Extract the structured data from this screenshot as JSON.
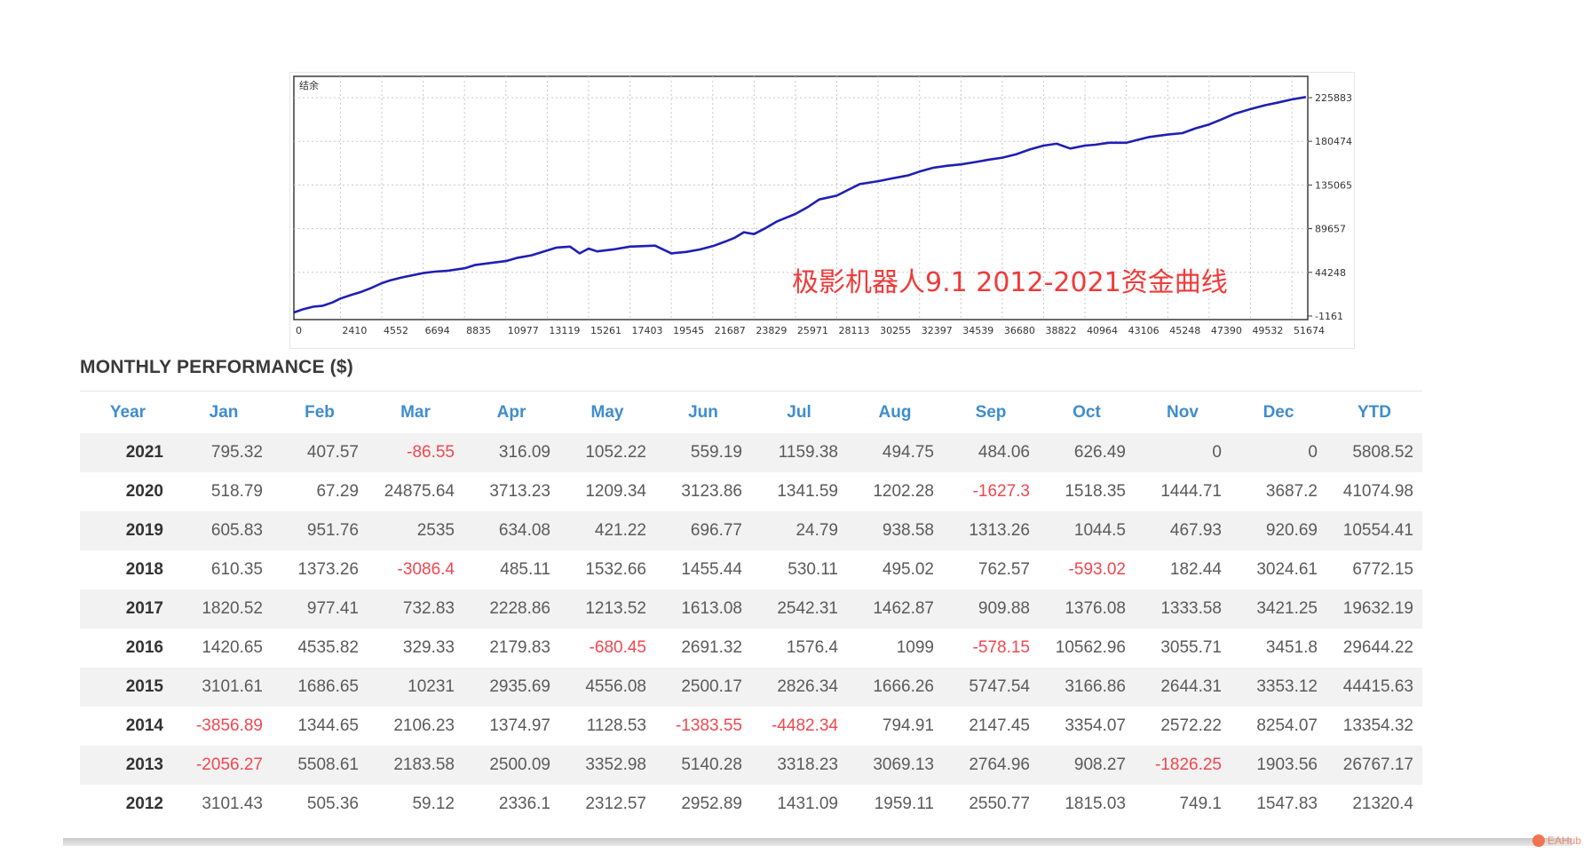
{
  "chart_data": {
    "type": "line",
    "corner_label": "结余",
    "overlay_text": "极影机器人9.1  2012-2021资金曲线",
    "x_ticks": [
      "0",
      "2410",
      "4552",
      "6694",
      "8835",
      "10977",
      "13119",
      "15261",
      "17403",
      "19545",
      "21687",
      "23829",
      "25971",
      "28113",
      "30255",
      "32397",
      "34539",
      "36680",
      "38822",
      "40964",
      "43106",
      "45248",
      "47390",
      "49532",
      "51674"
    ],
    "y_ticks": [
      "225883",
      "180474",
      "135065",
      "89657",
      "44248",
      "-1161"
    ],
    "xlim": [
      0,
      52500
    ],
    "ylim": [
      -1161,
      225883
    ],
    "grid": true,
    "line_color": "#1f1fb4",
    "series": [
      {
        "x": [
          0,
          500,
          1000,
          1500,
          2000,
          2410,
          3000,
          3500,
          4000,
          4552,
          5000,
          5600,
          6200,
          6694,
          7300,
          8000,
          8835,
          9400,
          10200,
          10977,
          11600,
          12300,
          13119,
          13600,
          14300,
          14800,
          15261,
          15700,
          16500,
          17403,
          18000,
          18700,
          19545,
          20300,
          21000,
          21687,
          22300,
          22800,
          23300,
          23829,
          24400,
          25000,
          25971,
          26600,
          27200,
          28113,
          28700,
          29300,
          30255,
          31000,
          31800,
          32397,
          33100,
          33800,
          34539,
          35300,
          36000,
          36680,
          37400,
          38100,
          38822,
          39500,
          40200,
          40964,
          41500,
          42200,
          43106,
          43700,
          44300,
          45248,
          46000,
          46700,
          47390,
          48000,
          48700,
          49532,
          50300,
          51000,
          51674,
          52400
        ],
        "y": [
          2500,
          6000,
          8500,
          9500,
          13000,
          17000,
          21000,
          24000,
          28000,
          33000,
          36000,
          39000,
          41500,
          43500,
          45000,
          46000,
          48500,
          52000,
          54000,
          56000,
          59500,
          62000,
          67000,
          70000,
          71000,
          64000,
          69000,
          66000,
          68000,
          71000,
          71500,
          72000,
          64000,
          65500,
          68000,
          71500,
          76000,
          80000,
          86000,
          84000,
          90000,
          97000,
          105000,
          112000,
          120000,
          124000,
          130000,
          136000,
          139000,
          142000,
          145000,
          149000,
          153000,
          155000,
          156500,
          159000,
          161500,
          163500,
          167000,
          172000,
          176000,
          178000,
          173000,
          176000,
          177000,
          179000,
          179000,
          182000,
          185000,
          187500,
          189000,
          194000,
          198000,
          203000,
          209000,
          214000,
          218000,
          221000,
          224000,
          226500
        ]
      }
    ]
  },
  "monthly": {
    "title": "MONTHLY PERFORMANCE ($)",
    "headers": [
      "Year",
      "Jan",
      "Feb",
      "Mar",
      "Apr",
      "May",
      "Jun",
      "Jul",
      "Aug",
      "Sep",
      "Oct",
      "Nov",
      "Dec",
      "YTD"
    ],
    "rows": [
      [
        "2021",
        "795.32",
        "407.57",
        "-86.55",
        "316.09",
        "1052.22",
        "559.19",
        "1159.38",
        "494.75",
        "484.06",
        "626.49",
        "0",
        "0",
        "5808.52"
      ],
      [
        "2020",
        "518.79",
        "67.29",
        "24875.64",
        "3713.23",
        "1209.34",
        "3123.86",
        "1341.59",
        "1202.28",
        "-1627.3",
        "1518.35",
        "1444.71",
        "3687.2",
        "41074.98"
      ],
      [
        "2019",
        "605.83",
        "951.76",
        "2535",
        "634.08",
        "421.22",
        "696.77",
        "24.79",
        "938.58",
        "1313.26",
        "1044.5",
        "467.93",
        "920.69",
        "10554.41"
      ],
      [
        "2018",
        "610.35",
        "1373.26",
        "-3086.4",
        "485.11",
        "1532.66",
        "1455.44",
        "530.11",
        "495.02",
        "762.57",
        "-593.02",
        "182.44",
        "3024.61",
        "6772.15"
      ],
      [
        "2017",
        "1820.52",
        "977.41",
        "732.83",
        "2228.86",
        "1213.52",
        "1613.08",
        "2542.31",
        "1462.87",
        "909.88",
        "1376.08",
        "1333.58",
        "3421.25",
        "19632.19"
      ],
      [
        "2016",
        "1420.65",
        "4535.82",
        "329.33",
        "2179.83",
        "-680.45",
        "2691.32",
        "1576.4",
        "1099",
        "-578.15",
        "10562.96",
        "3055.71",
        "3451.8",
        "29644.22"
      ],
      [
        "2015",
        "3101.61",
        "1686.65",
        "10231",
        "2935.69",
        "4556.08",
        "2500.17",
        "2826.34",
        "1666.26",
        "5747.54",
        "3166.86",
        "2644.31",
        "3353.12",
        "44415.63"
      ],
      [
        "2014",
        "-3856.89",
        "1344.65",
        "2106.23",
        "1374.97",
        "1128.53",
        "-1383.55",
        "-4482.34",
        "794.91",
        "2147.45",
        "3354.07",
        "2572.22",
        "8254.07",
        "13354.32"
      ],
      [
        "2013",
        "-2056.27",
        "5508.61",
        "2183.58",
        "2500.09",
        "3352.98",
        "5140.28",
        "3318.23",
        "3069.13",
        "2764.96",
        "908.27",
        "-1826.25",
        "1903.56",
        "26767.17"
      ],
      [
        "2012",
        "3101.43",
        "505.36",
        "59.12",
        "2336.1",
        "2312.57",
        "2952.89",
        "1431.09",
        "1959.11",
        "2550.77",
        "1815.03",
        "749.1",
        "1547.83",
        "21320.4"
      ]
    ]
  },
  "watermark": "EAHub",
  "colors": {
    "header_blue": "#3f8dcc",
    "negative_red": "#f0474f",
    "overlay_red": "#f03a3a"
  }
}
